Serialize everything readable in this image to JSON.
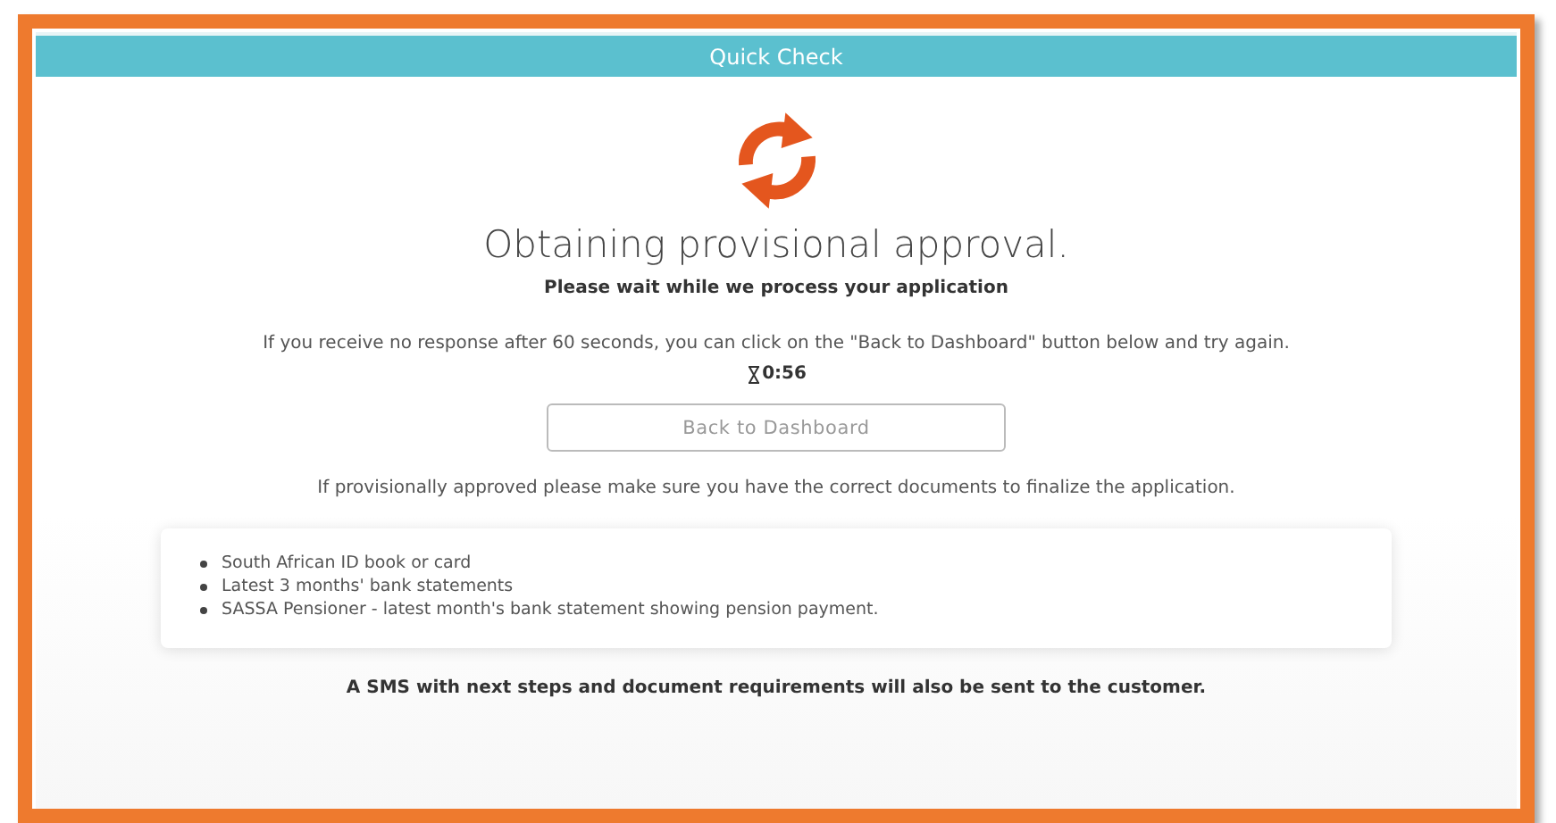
{
  "header": {
    "title": "Quick Check"
  },
  "heading": "Obtaining provisional approval.",
  "subheading": "Please wait while we process your application",
  "notice": "If you receive no response after 60 seconds, you can click on the \"Back to Dashboard\" button below and try again.",
  "timer": "0:56",
  "back_button": "Back to Dashboard",
  "documents_intro": "If provisionally approved please make sure you have the correct documents to finalize the application.",
  "documents": [
    "South African ID book or card",
    "Latest 3 months' bank statements",
    "SASSA Pensioner - latest month's bank statement showing pension payment."
  ],
  "footer_note": "A SMS with next steps and document requirements will also be sent to the customer."
}
